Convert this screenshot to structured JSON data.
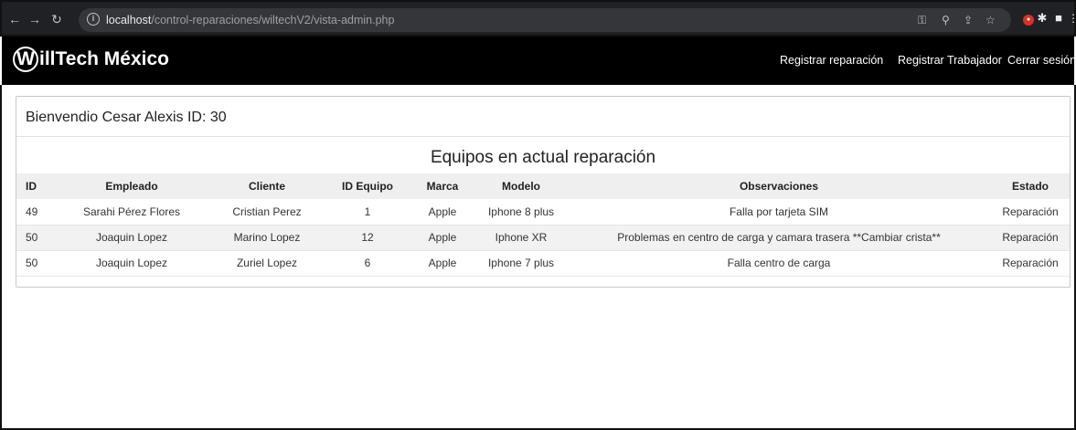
{
  "browser": {
    "url_host": "localhost",
    "url_path": "/control-reparaciones/wiltechV2/vista-admin.php"
  },
  "navbar": {
    "brand_initial": "W",
    "brand_rest": "illTech México",
    "links": [
      "Registrar reparación",
      "Registrar Trabajador",
      "Cerrar sesión"
    ]
  },
  "card": {
    "welcome": "Bienvendio Cesar Alexis ID: 30",
    "section_title": "Equipos en actual reparación"
  },
  "table": {
    "headers": [
      "ID",
      "Empleado",
      "Cliente",
      "ID Equipo",
      "Marca",
      "Modelo",
      "Observaciones",
      "Estado"
    ],
    "rows": [
      [
        "49",
        "Sarahi Pérez Flores",
        "Cristian Perez",
        "1",
        "Apple",
        "Iphone 8 plus",
        "Falla por tarjeta SIM",
        "Reparación"
      ],
      [
        "50",
        "Joaquin Lopez",
        "Marino Lopez",
        "12",
        "Apple",
        "Iphone XR",
        "Problemas en centro de carga y camara trasera **Cambiar crista**",
        "Reparación"
      ],
      [
        "50",
        "Joaquin Lopez",
        "Zuriel Lopez",
        "6",
        "Apple",
        "Iphone 7 plus",
        "Falla centro de carga",
        "Reparación"
      ]
    ]
  }
}
